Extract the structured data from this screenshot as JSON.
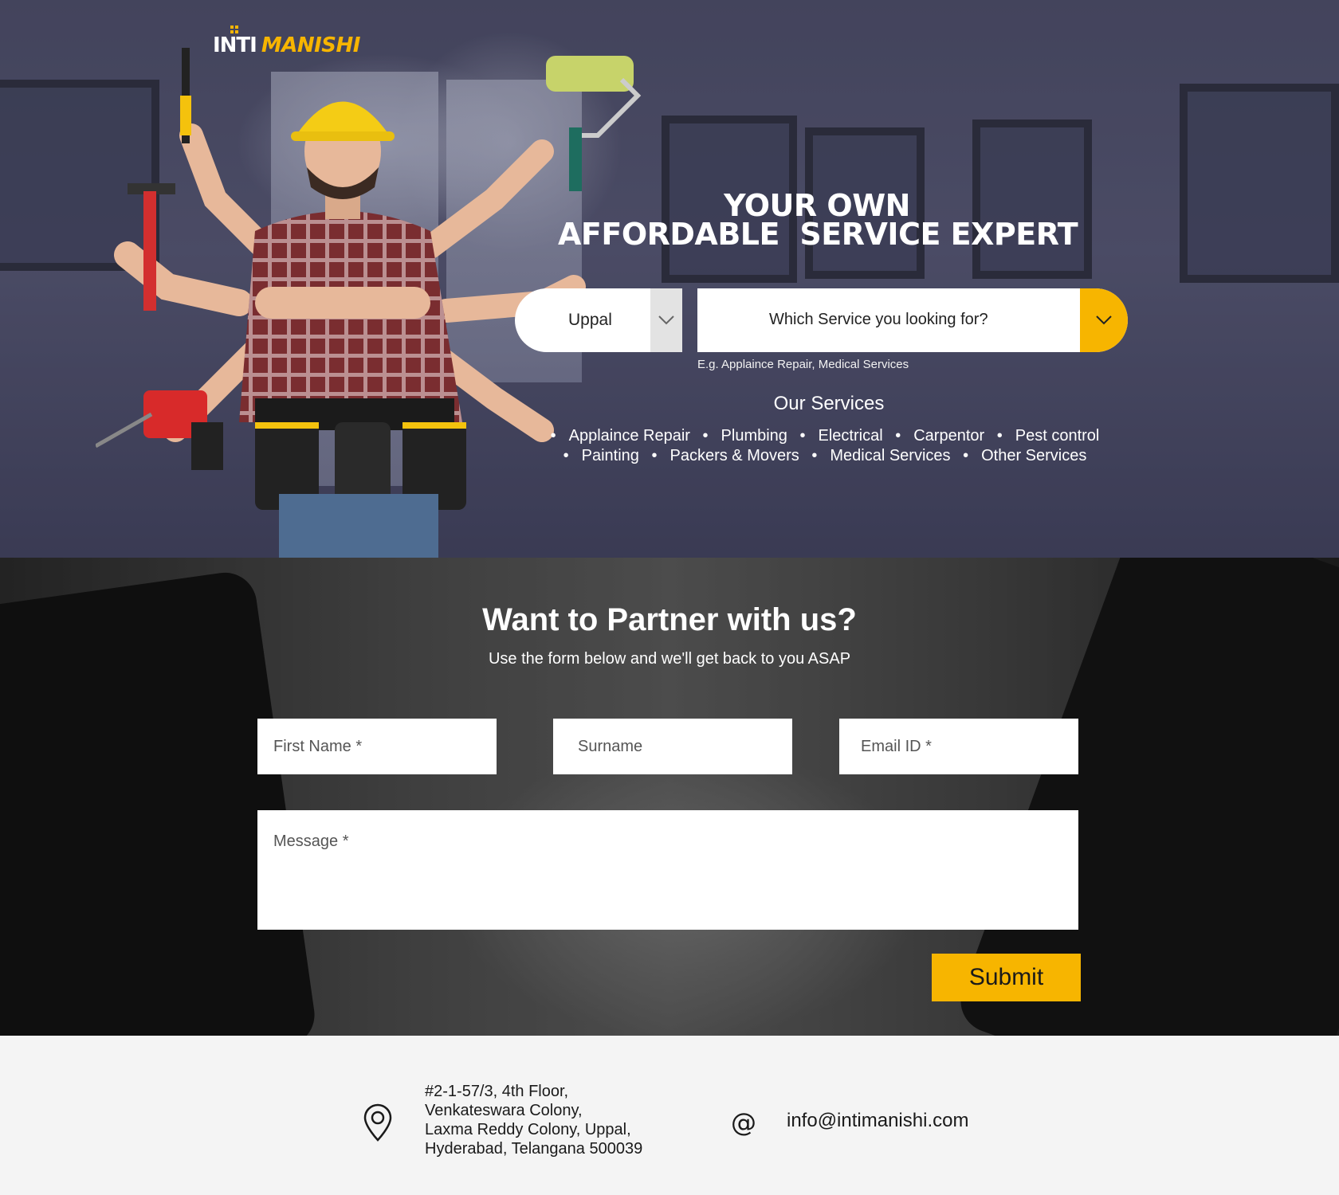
{
  "brand": {
    "logo_part1": "INTI",
    "logo_part2": "MANISHI"
  },
  "hero": {
    "title_line1": "YOUR OWN",
    "title_line2": "AFFORDABLE  SERVICE EXPERT",
    "location_value": "Uppal",
    "service_placeholder": "Which Service you looking for?",
    "service_hint": "E.g. Applaince Repair, Medical Services",
    "services_title": "Our Services",
    "services": [
      "Applaince Repair",
      "Plumbing",
      "Electrical",
      "Carpentor",
      "Pest control",
      "Painting",
      "Packers & Movers",
      "Medical Services",
      "Other Services"
    ]
  },
  "partner": {
    "title": "Want to Partner with us?",
    "subtitle": "Use the form below and we'll get back to you ASAP",
    "first_name_placeholder": "First Name *",
    "surname_placeholder": "Surname",
    "email_placeholder": "Email ID *",
    "message_placeholder": "Message *",
    "submit_label": "Submit"
  },
  "footer": {
    "address_lines": [
      "#2-1-57/3, 4th Floor,",
      "Venkateswara Colony,",
      "Laxma Reddy Colony, Uppal,",
      "Hyderabad, Telangana 500039"
    ],
    "at_symbol": "@",
    "email": "info@intimanishi.com"
  },
  "colors": {
    "accent": "#f7b500",
    "dark_band": "#3a3a3a",
    "footer_bg": "#f4f4f4"
  },
  "icons": {
    "location": "map-pin-icon",
    "email": "at-sign-icon",
    "dropdown": "chevron-down-icon"
  }
}
